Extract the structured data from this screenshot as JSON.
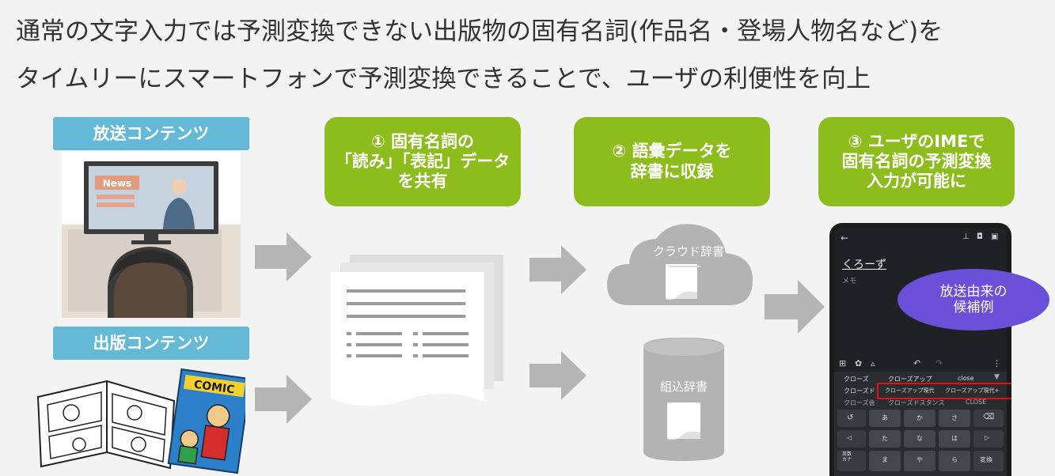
{
  "header": {
    "line1": "通常の文字入力では予測変換できない出版物の固有名詞(作品名・登場人物名など)を",
    "line2": "タイムリーにスマートフォンで予測変換できることで、ユーザの利便性を向上"
  },
  "sources": {
    "broadcast_label": "放送コンテンツ",
    "news_label": "News",
    "publication_label": "出版コンテンツ",
    "comic_label": "COMIC"
  },
  "steps": [
    {
      "text": "① 固有名詞の\n「読み」「表記」データ\nを共有"
    },
    {
      "text": "② 語彙データを\n辞書に収録"
    },
    {
      "text": "③ ユーザのIMEで\n固有名詞の予測変換\n入力が可能に"
    }
  ],
  "dictionaries": {
    "cloud": "クラウド辞書",
    "builtin": "組込辞書"
  },
  "phone": {
    "input_text": "くろーず",
    "memo_label": "メモ",
    "callout": "放送由来の\n候補例",
    "candidate_rows": [
      [
        "クローズ",
        "クローズアップ",
        "close"
      ],
      [
        "クローズド",
        "クローズアップ現代",
        "クローズアップ現代+"
      ],
      [
        "クローズ会",
        "クローズドスタンス",
        "CLOSE"
      ]
    ],
    "key_rows": [
      [
        "あ",
        "か",
        "さ"
      ],
      [
        "た",
        "な",
        "は"
      ],
      [
        "ま",
        "や",
        "ら"
      ]
    ],
    "side_left": [
      "↺",
      "◁",
      "英数\nカナ"
    ],
    "side_right": [
      "⌫",
      "▷",
      "変換"
    ]
  },
  "colors": {
    "green": "#8cbd1c",
    "blue_tag": "#64b9d6",
    "arrow": "#b5b5b5",
    "callout": "#6a4fd8",
    "highlight": "#e0101a"
  }
}
